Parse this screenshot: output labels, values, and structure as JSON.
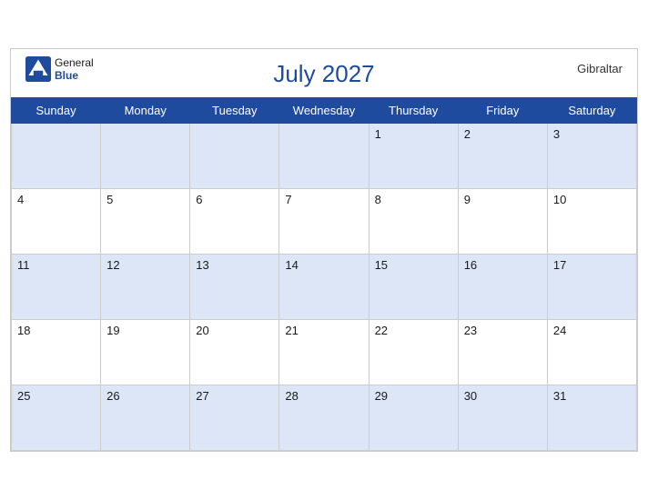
{
  "header": {
    "title": "July 2027",
    "region": "Gibraltar",
    "logo_general": "General",
    "logo_blue": "Blue"
  },
  "weekdays": [
    "Sunday",
    "Monday",
    "Tuesday",
    "Wednesday",
    "Thursday",
    "Friday",
    "Saturday"
  ],
  "weeks": [
    [
      null,
      null,
      null,
      null,
      1,
      2,
      3
    ],
    [
      4,
      5,
      6,
      7,
      8,
      9,
      10
    ],
    [
      11,
      12,
      13,
      14,
      15,
      16,
      17
    ],
    [
      18,
      19,
      20,
      21,
      22,
      23,
      24
    ],
    [
      25,
      26,
      27,
      28,
      29,
      30,
      31
    ]
  ]
}
